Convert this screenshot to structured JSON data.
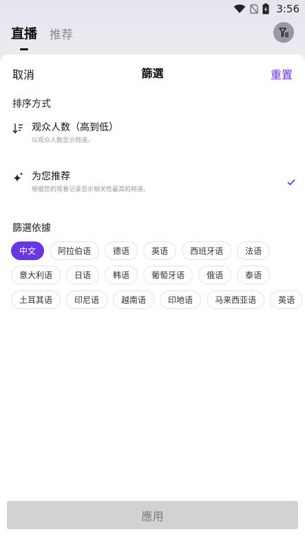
{
  "status_bar": {
    "time": "3:56"
  },
  "background_tabs": [
    {
      "label": "直播",
      "active": true
    },
    {
      "label": "推荐",
      "active": false
    }
  ],
  "sheet": {
    "cancel_label": "取消",
    "title": "篩選",
    "reset_label": "重置"
  },
  "sort": {
    "section_title": "排序方式",
    "options": [
      {
        "label": "观众人数（高到低）",
        "desc": "以观众人数显示频道。",
        "selected": false,
        "icon": "sort-descending-icon"
      },
      {
        "label": "为您推荐",
        "desc": "根据您的观看记录显示相关性最高的频道。",
        "selected": true,
        "icon": "sparkle-icon"
      }
    ]
  },
  "filter": {
    "section_title": "篩選依據",
    "rows": [
      [
        "中文",
        "阿拉伯语",
        "德语",
        "英语",
        "西班牙语",
        "法语"
      ],
      [
        "意大利语",
        "日语",
        "韩语",
        "葡萄牙语",
        "俄语",
        "泰语"
      ],
      [
        "土耳其语",
        "印尼语",
        "越南语",
        "印地语",
        "马来西亚语",
        "英语"
      ]
    ],
    "selected": "中文"
  },
  "apply_label": "應用",
  "colors": {
    "accent": "#6a36e0",
    "apply_disabled_bg": "#d2d2d2"
  }
}
